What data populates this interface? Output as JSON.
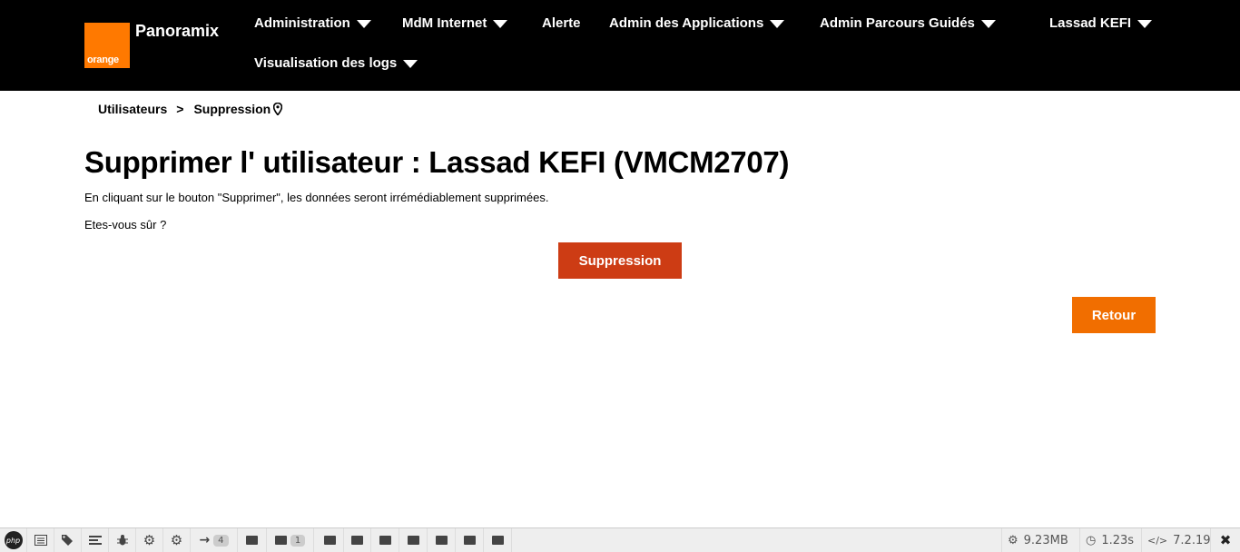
{
  "header": {
    "logo_text": "orange",
    "brand": "Panoramix",
    "nav": {
      "administration": "Administration",
      "mdm_internet": "MdM Internet",
      "alerte": "Alerte",
      "admin_applications": "Admin des Applications",
      "admin_parcours": "Admin Parcours Guidés",
      "user": "Lassad KEFI",
      "logs": "Visualisation des logs"
    }
  },
  "breadcrumb": {
    "item1": "Utilisateurs",
    "separator": ">",
    "item2": "Suppression"
  },
  "main": {
    "title": "Supprimer l' utilisateur : Lassad KEFI (VMCM2707)",
    "warning": "En cliquant sur le bouton \"Supprimer\", les données seront irrémédiablement supprimées.",
    "confirm": "Etes-vous sûr ?",
    "delete_button": "Suppression",
    "back_button": "Retour"
  },
  "colors": {
    "header_bg": "#000000",
    "orange": "#ff7900",
    "delete": "#cd3c14",
    "back": "#f16e00"
  },
  "debugbar": {
    "php_label": "php",
    "badge_route": "4",
    "badge_views": "1",
    "memory": "9.23MB",
    "time": "1.23s",
    "version": "7.2.19"
  }
}
